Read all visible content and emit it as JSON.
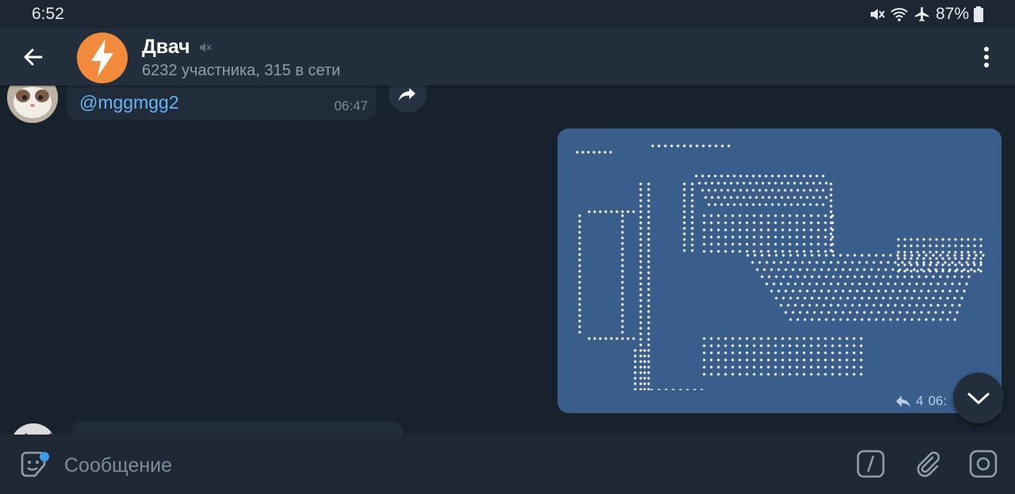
{
  "status_bar": {
    "time": "6:52",
    "battery": "87%"
  },
  "header": {
    "title": "Двач",
    "subtitle": "6232 участника, 315 в сети"
  },
  "messages": [
    {
      "mention": "@mggmgg2",
      "time": "06:47"
    },
    {
      "replies_count": "4",
      "time_partial": "06:"
    }
  ],
  "composer": {
    "placeholder": "Сообщение"
  },
  "colors": {
    "background": "#18222d",
    "header": "#232e3c",
    "outgoing_bubble": "#3a5e8c",
    "incoming_bubble": "#202c3a",
    "link": "#6ab2f2",
    "avatar_orange": "#f28c3c"
  },
  "icons": [
    "back-arrow-icon",
    "muted-icon",
    "more-vert-icon",
    "share-icon",
    "reply-icon",
    "chevron-down-icon",
    "sticker-icon",
    "bot-command-icon",
    "attach-icon",
    "camera-icon",
    "mute-icon",
    "wifi-icon",
    "airplane-icon",
    "battery-icon"
  ]
}
